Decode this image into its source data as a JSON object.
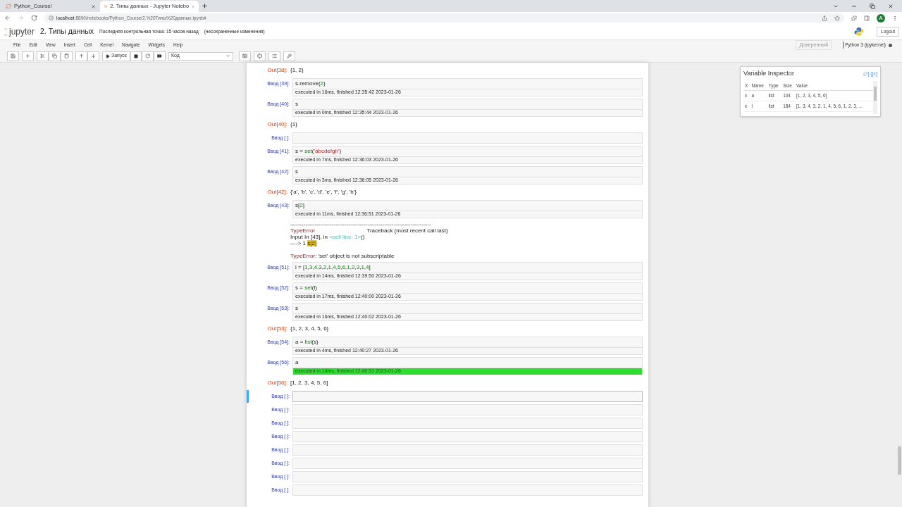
{
  "browser": {
    "tabs": [
      {
        "title": "Python_Course/",
        "selected": false
      },
      {
        "title": "2. Типы данных - Jupyter Notebo",
        "selected": true
      }
    ],
    "url_host": "localhost",
    "url_rest": ":8890/notebooks/Python_Course/2.%20Типы%20данных.ipynb#",
    "profile": "A"
  },
  "header": {
    "logo": "jupyter",
    "title": "2. Типы данных",
    "checkpoint": "Последняя контрольная точка: 15 часов назад",
    "unsaved": "(несохраненные изменения)",
    "logout": "Logout"
  },
  "menu": [
    "File",
    "Edit",
    "View",
    "Insert",
    "Cell",
    "Kernel",
    "Navigate",
    "Widgets",
    "Help"
  ],
  "trusted": "Доверенный",
  "kernel": "Python 3 (ipykernel)",
  "toolbar": {
    "run": "Запуск",
    "cell_type": "Код"
  },
  "cells": [
    {
      "kind": "output",
      "prompt": "Out[38]:",
      "text": "{1, 2}"
    },
    {
      "kind": "code",
      "prompt": "Ввод [39]:",
      "code": [
        {
          "t": "s.remove(",
          "kind": "plain"
        },
        {
          "t": "2",
          "kind": "num"
        },
        {
          "t": ")",
          "kind": "plain"
        }
      ],
      "timing": "executed in 16ms, finished 12:35:42 2023-01-26",
      "highlight": false,
      "selected": false
    },
    {
      "kind": "code",
      "prompt": "Ввод [40]:",
      "code": [
        {
          "t": "s",
          "kind": "plain"
        }
      ],
      "timing": "executed in 0ms, finished 12:35:44 2023-01-26",
      "highlight": false,
      "selected": false
    },
    {
      "kind": "output",
      "prompt": "Out[40]:",
      "text": "{1}"
    },
    {
      "kind": "code",
      "prompt": "Ввод [ ]:",
      "selected": false
    },
    {
      "kind": "code",
      "prompt": "Ввод [41]:",
      "code": [
        {
          "t": "s = ",
          "kind": "plain"
        },
        {
          "t": "set",
          "kind": "builtin"
        },
        {
          "t": "(",
          "kind": "plain"
        },
        {
          "t": "'abcdefgh'",
          "kind": "str"
        },
        {
          "t": ")",
          "kind": "plain"
        }
      ],
      "timing": "executed in 7ms, finished 12:36:03 2023-01-26",
      "highlight": false,
      "selected": false
    },
    {
      "kind": "code",
      "prompt": "Ввод [42]:",
      "code": [
        {
          "t": "s",
          "kind": "plain"
        }
      ],
      "timing": "executed in 3ms, finished 12:36:05 2023-01-26",
      "highlight": false,
      "selected": false
    },
    {
      "kind": "output",
      "prompt": "Out[42]:",
      "text": "{'a', 'b', 'c', 'd', 'e', 'f', 'g', 'h'}"
    },
    {
      "kind": "code",
      "prompt": "Ввод [43]:",
      "code": [
        {
          "t": "s[",
          "kind": "plain"
        },
        {
          "t": "2",
          "kind": "num"
        },
        {
          "t": "]",
          "kind": "plain"
        }
      ],
      "timing": "executed in 11ms, finished 12:36:51 2023-01-26",
      "highlight": false,
      "selected": false
    },
    {
      "kind": "error",
      "lines": [
        [
          {
            "t": "---------------------------------------------------------------------------",
            "kind": "plain"
          }
        ],
        [
          {
            "t": "TypeError",
            "kind": "err"
          },
          {
            "t": "                                 Traceback (most recent call last)",
            "kind": "plain"
          }
        ],
        [
          {
            "t": "Input In [43], in ",
            "kind": "plain"
          },
          {
            "t": "<cell line: 1>",
            "kind": "link"
          },
          {
            "t": "()",
            "kind": "plain"
          }
        ],
        [
          {
            "t": "----> 1 ",
            "kind": "plain"
          },
          {
            "t": "s[2]",
            "kind": "hl"
          }
        ],
        [
          {
            "t": "TypeError",
            "kind": "err"
          },
          {
            "t": ": 'set' object is not subscriptable",
            "kind": "plain"
          }
        ]
      ]
    },
    {
      "kind": "code",
      "prompt": "Ввод [51]:",
      "code": [
        {
          "t": "l = [",
          "kind": "plain"
        },
        {
          "t": "1",
          "kind": "num"
        },
        {
          "t": ",",
          "kind": "plain"
        },
        {
          "t": "3",
          "kind": "num"
        },
        {
          "t": ",",
          "kind": "plain"
        },
        {
          "t": "4",
          "kind": "num"
        },
        {
          "t": ",",
          "kind": "plain"
        },
        {
          "t": "3",
          "kind": "num"
        },
        {
          "t": ",",
          "kind": "plain"
        },
        {
          "t": "2",
          "kind": "num"
        },
        {
          "t": ",",
          "kind": "plain"
        },
        {
          "t": "1",
          "kind": "num"
        },
        {
          "t": ",",
          "kind": "plain"
        },
        {
          "t": "4",
          "kind": "num"
        },
        {
          "t": ",",
          "kind": "plain"
        },
        {
          "t": "5",
          "kind": "num"
        },
        {
          "t": ",",
          "kind": "plain"
        },
        {
          "t": "6",
          "kind": "num"
        },
        {
          "t": ",",
          "kind": "plain"
        },
        {
          "t": "1",
          "kind": "num"
        },
        {
          "t": ",",
          "kind": "plain"
        },
        {
          "t": "2",
          "kind": "num"
        },
        {
          "t": ",",
          "kind": "plain"
        },
        {
          "t": "3",
          "kind": "num"
        },
        {
          "t": ",",
          "kind": "plain"
        },
        {
          "t": "1",
          "kind": "num"
        },
        {
          "t": ",",
          "kind": "plain"
        },
        {
          "t": "4",
          "kind": "num"
        },
        {
          "t": "]",
          "kind": "plain"
        }
      ],
      "timing": "executed in 14ms, finished 12:39:50 2023-01-26",
      "highlight": false,
      "selected": false
    },
    {
      "kind": "code",
      "prompt": "Ввод [52]:",
      "code": [
        {
          "t": "s = ",
          "kind": "plain"
        },
        {
          "t": "set",
          "kind": "builtin"
        },
        {
          "t": "(l)",
          "kind": "plain"
        }
      ],
      "timing": "executed in 17ms, finished 12:40:00 2023-01-26",
      "highlight": false,
      "selected": false
    },
    {
      "kind": "code",
      "prompt": "Ввод [53]:",
      "code": [
        {
          "t": "s",
          "kind": "plain"
        }
      ],
      "timing": "executed in 16ms, finished 12:40:02 2023-01-26",
      "highlight": false,
      "selected": false
    },
    {
      "kind": "output",
      "prompt": "Out[53]:",
      "text": "{1, 2, 3, 4, 5, 6}"
    },
    {
      "kind": "code",
      "prompt": "Ввод [54]:",
      "code": [
        {
          "t": "a = ",
          "kind": "plain"
        },
        {
          "t": "list",
          "kind": "builtin"
        },
        {
          "t": "(s)",
          "kind": "plain"
        }
      ],
      "timing": "executed in 4ms, finished 12:40:27 2023-01-26",
      "highlight": false,
      "selected": false
    },
    {
      "kind": "code",
      "prompt": "Ввод [56]:",
      "code": [
        {
          "t": "a",
          "kind": "plain"
        }
      ],
      "timing": "executed in 14ms, finished 12:40:31 2023-01-26",
      "highlight": true,
      "selected": false
    },
    {
      "kind": "output",
      "prompt": "Out[56]:",
      "text": "[1, 2, 3, 4, 5, 6]"
    },
    {
      "kind": "code",
      "prompt": "Ввод [ ]:",
      "selected": true
    },
    {
      "kind": "code",
      "prompt": "Ввод [ ]:",
      "selected": false
    },
    {
      "kind": "code",
      "prompt": "Ввод [ ]:",
      "selected": false
    },
    {
      "kind": "code",
      "prompt": "Ввод [ ]:",
      "selected": false
    },
    {
      "kind": "code",
      "prompt": "Ввод [ ]:",
      "selected": false
    },
    {
      "kind": "code",
      "prompt": "Ввод [ ]:",
      "selected": false
    },
    {
      "kind": "code",
      "prompt": "Ввод [ ]:",
      "selected": false
    },
    {
      "kind": "code",
      "prompt": "Ввод [ ]:",
      "selected": false
    }
  ],
  "inspector": {
    "title": "Variable Inspector",
    "controls": "[-][x]",
    "columns": [
      "X",
      "Name",
      "Type",
      "Size",
      "Value"
    ],
    "rows": [
      {
        "x": "x",
        "name": "a",
        "type": "list",
        "size": "104",
        "value": "[1, 2, 3, 4, 5, 6]"
      },
      {
        "x": "x",
        "name": "l",
        "type": "list",
        "size": "184",
        "value": "[1, 3, 4, 3, 2, 1, 4, 5, 6, 1, 2, 3, ..."
      }
    ]
  }
}
